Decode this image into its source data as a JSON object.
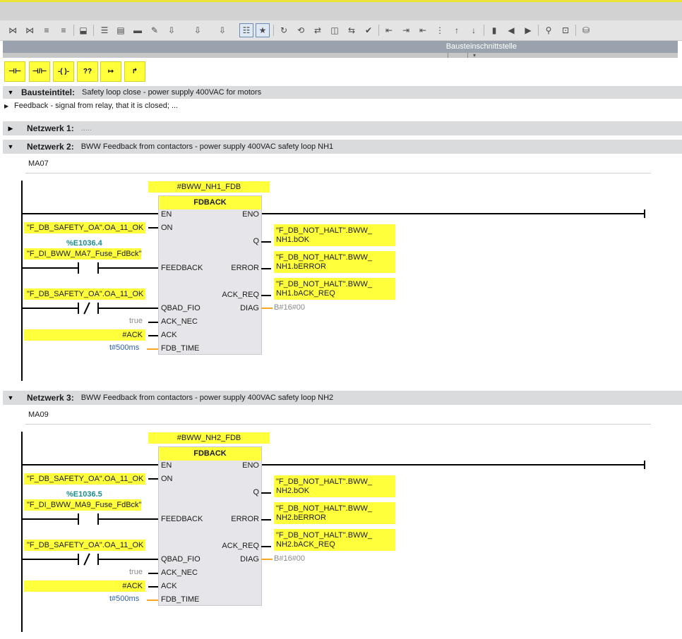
{
  "toolbar": {
    "interface_label": "Bausteinschnittstelle",
    "icons": [
      "insert-network-icon",
      "delete-network-icon",
      "insert-row-icon",
      "add-row-icon",
      "download-icon",
      "absolute-operands-icon",
      "zoom-icon",
      "tree-view-icon",
      "comments-icon",
      "insert-input-icon",
      "insert-output-icon",
      "insert-branch-icon",
      "network-view-icon",
      "favorites-icon",
      "go-online-icon",
      "monitor-icon",
      "compare-icon",
      "snapshot-icon",
      "status-icon",
      "check-icon",
      "indent-left-icon",
      "indent-right-icon",
      "outdent-icon",
      "align-icon",
      "move-up-icon",
      "move-down-icon",
      "bookmark-icon",
      "previous-bookmark-icon",
      "next-bookmark-icon",
      "monitoring-on-icon",
      "monitoring-off-icon",
      "database-icon"
    ]
  },
  "ladder_tools": {
    "buttons": [
      {
        "name": "no-contact",
        "glyph": "⊣⊢"
      },
      {
        "name": "nc-contact",
        "glyph": "⊣/⊢"
      },
      {
        "name": "coil",
        "glyph": "-( )-"
      },
      {
        "name": "empty-box",
        "glyph": "??"
      },
      {
        "name": "open-branch",
        "glyph": "↦"
      },
      {
        "name": "close-branch",
        "glyph": "↱"
      }
    ]
  },
  "block": {
    "title_label": "Bausteintitel:",
    "title_value": "Safety loop close - power supply 400VAC for motors",
    "comment": "Feedback - signal from relay, that it is closed; ..."
  },
  "networks": [
    {
      "label": "Netzwerk 1:",
      "title": "....."
    },
    {
      "label": "Netzwerk 2:",
      "title": "BWW Feedback from contactors - power supply 400VAC safety loop NH1",
      "comment": "MA07",
      "instance": "#BWW_NH1_FDB",
      "fb_name": "FDBACK",
      "pins_in": [
        "EN",
        "ON",
        "FEEDBACK",
        "QBAD_FIO",
        "ACK_NEC",
        "ACK",
        "FDB_TIME"
      ],
      "pins_out": [
        "ENO",
        "Q",
        "ERROR",
        "ACK_REQ",
        "DIAG"
      ],
      "on_operand": "\"F_DB_SAFETY_OA\".OA_11_OK",
      "feedback_address": "%E1036.4",
      "feedback_operand": "\"F_DI_BWW_MA7_Fuse_FdBck\"",
      "qbad_operand": "\"F_DB_SAFETY_OA\".OA_11_OK",
      "ack_nec": "true",
      "ack": "#ACK",
      "fdb_time": "t#500ms",
      "q_operand": "\"F_DB_NOT_HALT\".BWW_\nNH1.bOK",
      "error_operand": "\"F_DB_NOT_HALT\".BWW_\nNH1.bERROR",
      "ack_req_operand": "\"F_DB_NOT_HALT\".BWW_\nNH1.bACK_REQ",
      "diag": "B#16#00"
    },
    {
      "label": "Netzwerk 3:",
      "title": "BWW Feedback from contactors - power supply 400VAC safety loop NH2",
      "comment": "MA09",
      "instance": "#BWW_NH2_FDB",
      "fb_name": "FDBACK",
      "pins_in": [
        "EN",
        "ON",
        "FEEDBACK",
        "QBAD_FIO",
        "ACK_NEC",
        "ACK",
        "FDB_TIME"
      ],
      "pins_out": [
        "ENO",
        "Q",
        "ERROR",
        "ACK_REQ",
        "DIAG"
      ],
      "on_operand": "\"F_DB_SAFETY_OA\".OA_11_OK",
      "feedback_address": "%E1036.5",
      "feedback_operand": "\"F_DI_BWW_MA9_Fuse_FdBck\"",
      "qbad_operand": "\"F_DB_SAFETY_OA\".OA_11_OK",
      "ack_nec": "true",
      "ack": "#ACK",
      "fdb_time": "t#500ms",
      "q_operand": "\"F_DB_NOT_HALT\".BWW_\nNH2.bOK",
      "error_operand": "\"F_DB_NOT_HALT\".BWW_\nNH2.bERROR",
      "ack_req_operand": "\"F_DB_NOT_HALT\".BWW_\nNH2.bACK_REQ",
      "diag": "B#16#00"
    }
  ]
}
